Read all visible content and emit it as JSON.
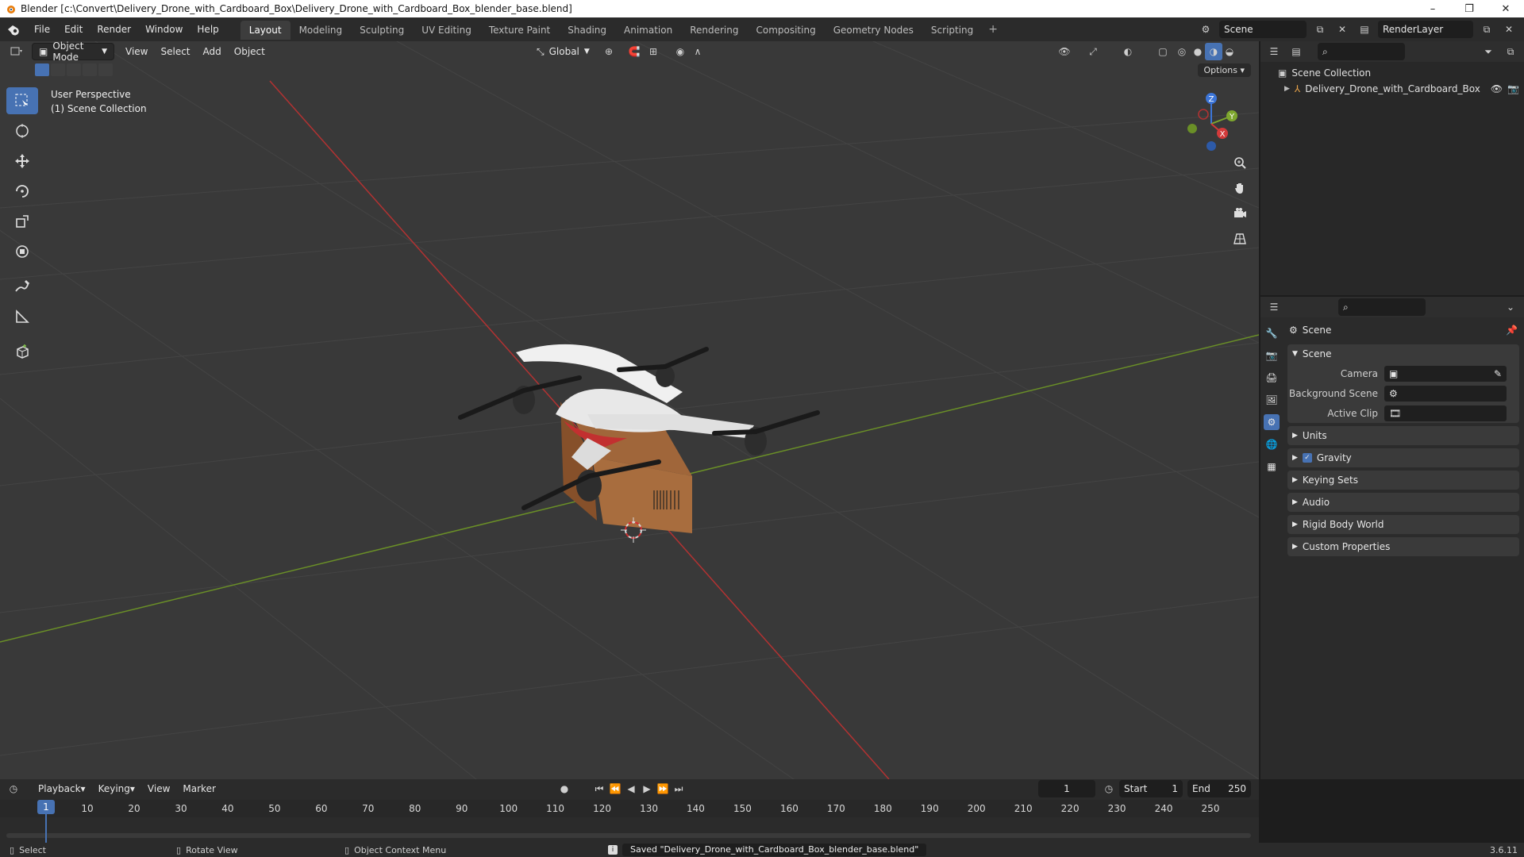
{
  "window": {
    "title": "Blender [c:\\Convert\\Delivery_Drone_with_Cardboard_Box\\Delivery_Drone_with_Cardboard_Box_blender_base.blend]"
  },
  "menu": [
    "File",
    "Edit",
    "Render",
    "Window",
    "Help"
  ],
  "workspaces": [
    "Layout",
    "Modeling",
    "Sculpting",
    "UV Editing",
    "Texture Paint",
    "Shading",
    "Animation",
    "Rendering",
    "Compositing",
    "Geometry Nodes",
    "Scripting"
  ],
  "active_workspace": "Layout",
  "top_right": {
    "scene": "Scene",
    "view_layer": "RenderLayer"
  },
  "viewport": {
    "mode": "Object Mode",
    "menus": [
      "View",
      "Select",
      "Add",
      "Object"
    ],
    "transform_orientation": "Global",
    "options": "Options",
    "overlay_text": [
      "User Perspective",
      "(1) Scene Collection"
    ],
    "gizmo_axes": [
      "X",
      "Y",
      "Z"
    ]
  },
  "outliner": {
    "root": "Scene Collection",
    "items": [
      "Delivery_Drone_with_Cardboard_Box"
    ]
  },
  "properties": {
    "context_name": "Scene",
    "panel_open": "Scene",
    "fields": [
      {
        "label": "Camera",
        "value": ""
      },
      {
        "label": "Background Scene",
        "value": ""
      },
      {
        "label": "Active Clip",
        "value": ""
      }
    ],
    "panels": [
      "Units",
      "Gravity",
      "Keying Sets",
      "Audio",
      "Rigid Body World",
      "Custom Properties"
    ],
    "gravity_checked": true
  },
  "timeline": {
    "menus": [
      "Playback",
      "Keying",
      "View",
      "Marker"
    ],
    "current_frame": "1",
    "start_label": "Start",
    "start": "1",
    "end_label": "End",
    "end": "250",
    "ticks": [
      "10",
      "20",
      "30",
      "40",
      "50",
      "60",
      "70",
      "80",
      "90",
      "100",
      "110",
      "120",
      "130",
      "140",
      "150",
      "160",
      "170",
      "180",
      "190",
      "200",
      "210",
      "220",
      "230",
      "240",
      "250"
    ],
    "playhead_label": "1"
  },
  "statusbar": {
    "select": "Select",
    "rotate": "Rotate View",
    "context_menu": "Object Context Menu",
    "message": "Saved \"Delivery_Drone_with_Cardboard_Box_blender_base.blend\"",
    "version": "3.6.11"
  },
  "colors": {
    "accent": "#4772b3",
    "x_axis": "#d33a3a",
    "y_axis": "#7ea72e",
    "z_axis": "#3c75d8"
  }
}
